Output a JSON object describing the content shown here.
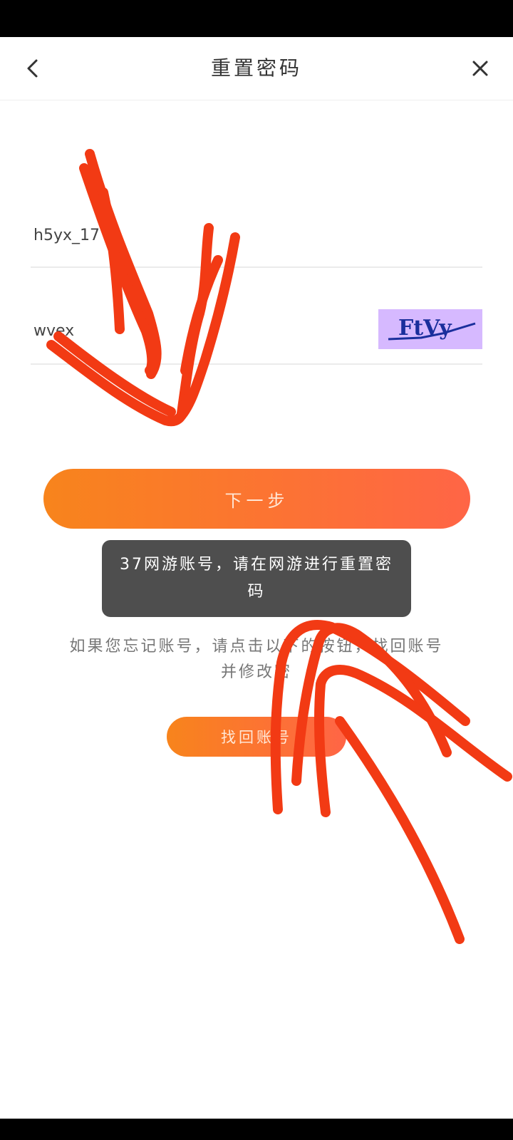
{
  "header": {
    "title": "重置密码",
    "back_icon": "chevron-left-icon",
    "close_icon": "close-icon"
  },
  "form": {
    "account_value": "h5yx_17",
    "captcha_value": "wvex",
    "captcha_image_text": "FtVy"
  },
  "next_button": {
    "label": "下一步"
  },
  "toast": {
    "message": "37网游账号，请在网游进行重置密码"
  },
  "hint": {
    "text": "如果您忘记账号，请点击以下的按钮，找回账号并修改密"
  },
  "find_account_button": {
    "label": "找回账号"
  },
  "colors": {
    "accent_start": "#f8841c",
    "accent_end": "#ff6546",
    "scribble": "#f23a14",
    "toast_bg": "#4e4e4e",
    "captcha_bg": "#d6b9ff"
  }
}
